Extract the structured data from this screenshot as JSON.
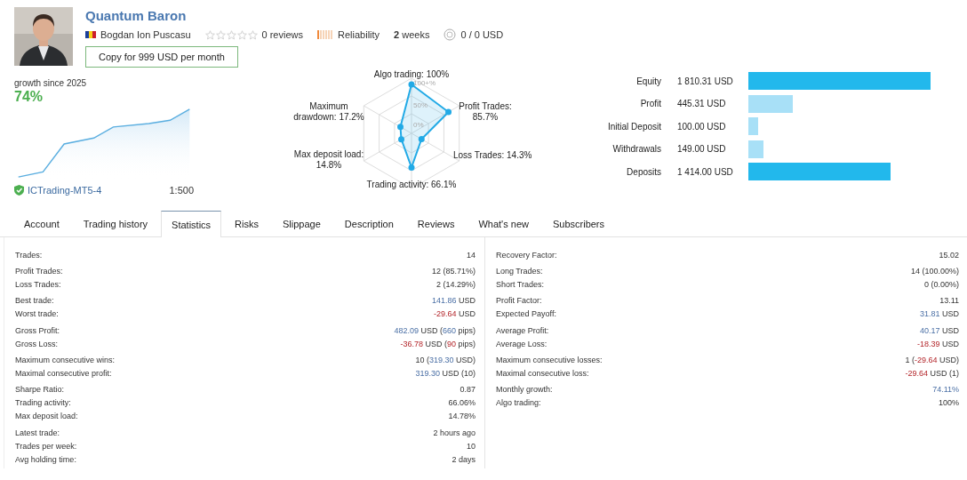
{
  "signal": {
    "name": "Quantum Baron",
    "author": "Bogdan Ion Puscasu",
    "stars": 0,
    "reviews": "0 reviews",
    "reliability": "Reliability",
    "age": "**2** weeks",
    "funds": "0 / 0 USD",
    "copy_button": "Copy for 999 USD per month"
  },
  "growth": {
    "caption": "growth since 2025",
    "value": "74%",
    "server": "ICTrading-MT5-4",
    "leverage": "1:500"
  },
  "radar": {
    "ticks": [
      "100+%",
      "50%",
      "0%"
    ],
    "axes": [
      {
        "label": "Algo trading: 100%"
      },
      {
        "label": "Maximum drawdown: 17.2%"
      },
      {
        "label": "Profit Trades: 85.7%"
      },
      {
        "label": "Max deposit load: 14.8%"
      },
      {
        "label": "Loss Trades: 14.3%"
      },
      {
        "label": "Trading activity: 66.1%"
      }
    ]
  },
  "balance": [
    {
      "label": "Equity",
      "value": "1 810.31 USD",
      "color": "#22b8ec"
    },
    {
      "label": "Profit",
      "value": "445.31 USD",
      "color": "#a8e0f7"
    },
    {
      "label": "Initial Deposit",
      "value": "100.00 USD",
      "color": "#a8e0f7"
    },
    {
      "label": "Withdrawals",
      "value": "149.00 USD",
      "color": "#a8e0f7"
    },
    {
      "label": "Deposits",
      "value": "1 414.00 USD",
      "color": "#22b8ec"
    }
  ],
  "tabs": [
    {
      "label": "Account",
      "selected": false
    },
    {
      "label": "Trading history",
      "selected": false
    },
    {
      "label": "Statistics",
      "selected": true
    },
    {
      "label": "Risks",
      "selected": false
    },
    {
      "label": "Slippage",
      "selected": false
    },
    {
      "label": "Description",
      "selected": false
    },
    {
      "label": "Reviews",
      "selected": false
    },
    {
      "label": "What's new",
      "selected": false
    },
    {
      "label": "Subscribers",
      "selected": false
    }
  ],
  "statistics": {
    "left": [
      [
        {
          "label": "Trades:",
          "value": [
            {
              "text": "14"
            }
          ]
        }
      ],
      [
        {
          "label": "Profit Trades:",
          "value": [
            {
              "text": "12 (85.71%)"
            }
          ]
        },
        {
          "label": "Loss Trades:",
          "value": [
            {
              "text": "2 (14.29%)"
            }
          ]
        }
      ],
      [
        {
          "label": "Best trade:",
          "value": [
            {
              "text": "141.86",
              "kind": "gain"
            },
            {
              "text": " USD"
            }
          ]
        },
        {
          "label": "Worst trade:",
          "value": [
            {
              "text": "-29.64",
              "kind": "loss"
            },
            {
              "text": " USD"
            }
          ]
        }
      ],
      [
        {
          "label": "Gross Profit:",
          "value": [
            {
              "text": "482.09",
              "kind": "gain"
            },
            {
              "text": " USD ("
            },
            {
              "text": "660",
              "kind": "gain"
            },
            {
              "text": " pips)"
            }
          ]
        },
        {
          "label": "Gross Loss:",
          "value": [
            {
              "text": "-36.78",
              "kind": "loss"
            },
            {
              "text": " USD ("
            },
            {
              "text": "90",
              "kind": "loss"
            },
            {
              "text": " pips)"
            }
          ]
        }
      ],
      [
        {
          "label": "Maximum consecutive wins:",
          "value": [
            {
              "text": "10 ("
            },
            {
              "text": "319.30",
              "kind": "gain"
            },
            {
              "text": " USD)"
            }
          ]
        },
        {
          "label": "Maximal consecutive profit:",
          "value": [
            {
              "text": "319.30",
              "kind": "gain"
            },
            {
              "text": " USD (10)"
            }
          ]
        }
      ],
      [
        {
          "label": "Sharpe Ratio:",
          "value": [
            {
              "text": "0.87"
            }
          ]
        },
        {
          "label": "Trading activity:",
          "value": [
            {
              "text": "66.06%"
            }
          ]
        },
        {
          "label": "Max deposit load:",
          "value": [
            {
              "text": "14.78%"
            }
          ]
        }
      ],
      [
        {
          "label": "Latest trade:",
          "value": [
            {
              "text": "2 hours ago"
            }
          ]
        },
        {
          "label": "Trades per week:",
          "value": [
            {
              "text": "10"
            }
          ]
        },
        {
          "label": "Avg holding time:",
          "value": [
            {
              "text": "2 days"
            }
          ]
        }
      ]
    ],
    "right": [
      [
        {
          "label": "Recovery Factor:",
          "value": [
            {
              "text": "15.02"
            }
          ]
        }
      ],
      [
        {
          "label": "Long Trades:",
          "value": [
            {
              "text": "14 (100.00%)"
            }
          ]
        },
        {
          "label": "Short Trades:",
          "value": [
            {
              "text": "0 (0.00%)"
            }
          ]
        }
      ],
      [
        {
          "label": "Profit Factor:",
          "value": [
            {
              "text": "13.11"
            }
          ]
        },
        {
          "label": "Expected Payoff:",
          "value": [
            {
              "text": "31.81",
              "kind": "gain"
            },
            {
              "text": " USD"
            }
          ]
        }
      ],
      [
        {
          "label": "Average Profit:",
          "value": [
            {
              "text": "40.17",
              "kind": "gain"
            },
            {
              "text": " USD"
            }
          ]
        },
        {
          "label": "Average Loss:",
          "value": [
            {
              "text": "-18.39",
              "kind": "loss"
            },
            {
              "text": " USD"
            }
          ]
        }
      ],
      [
        {
          "label": "Maximum consecutive losses:",
          "value": [
            {
              "text": "1 ("
            },
            {
              "text": "-29.64",
              "kind": "loss"
            },
            {
              "text": " USD)"
            }
          ]
        },
        {
          "label": "Maximal consecutive loss:",
          "value": [
            {
              "text": "-29.64",
              "kind": "loss"
            },
            {
              "text": " USD (1)"
            }
          ]
        }
      ],
      [
        {
          "label": "Monthly growth:",
          "value": [
            {
              "text": "74.11%",
              "kind": "gain"
            }
          ]
        },
        {
          "label": "Algo trading:",
          "value": [
            {
              "text": "100%"
            }
          ]
        }
      ]
    ]
  }
}
